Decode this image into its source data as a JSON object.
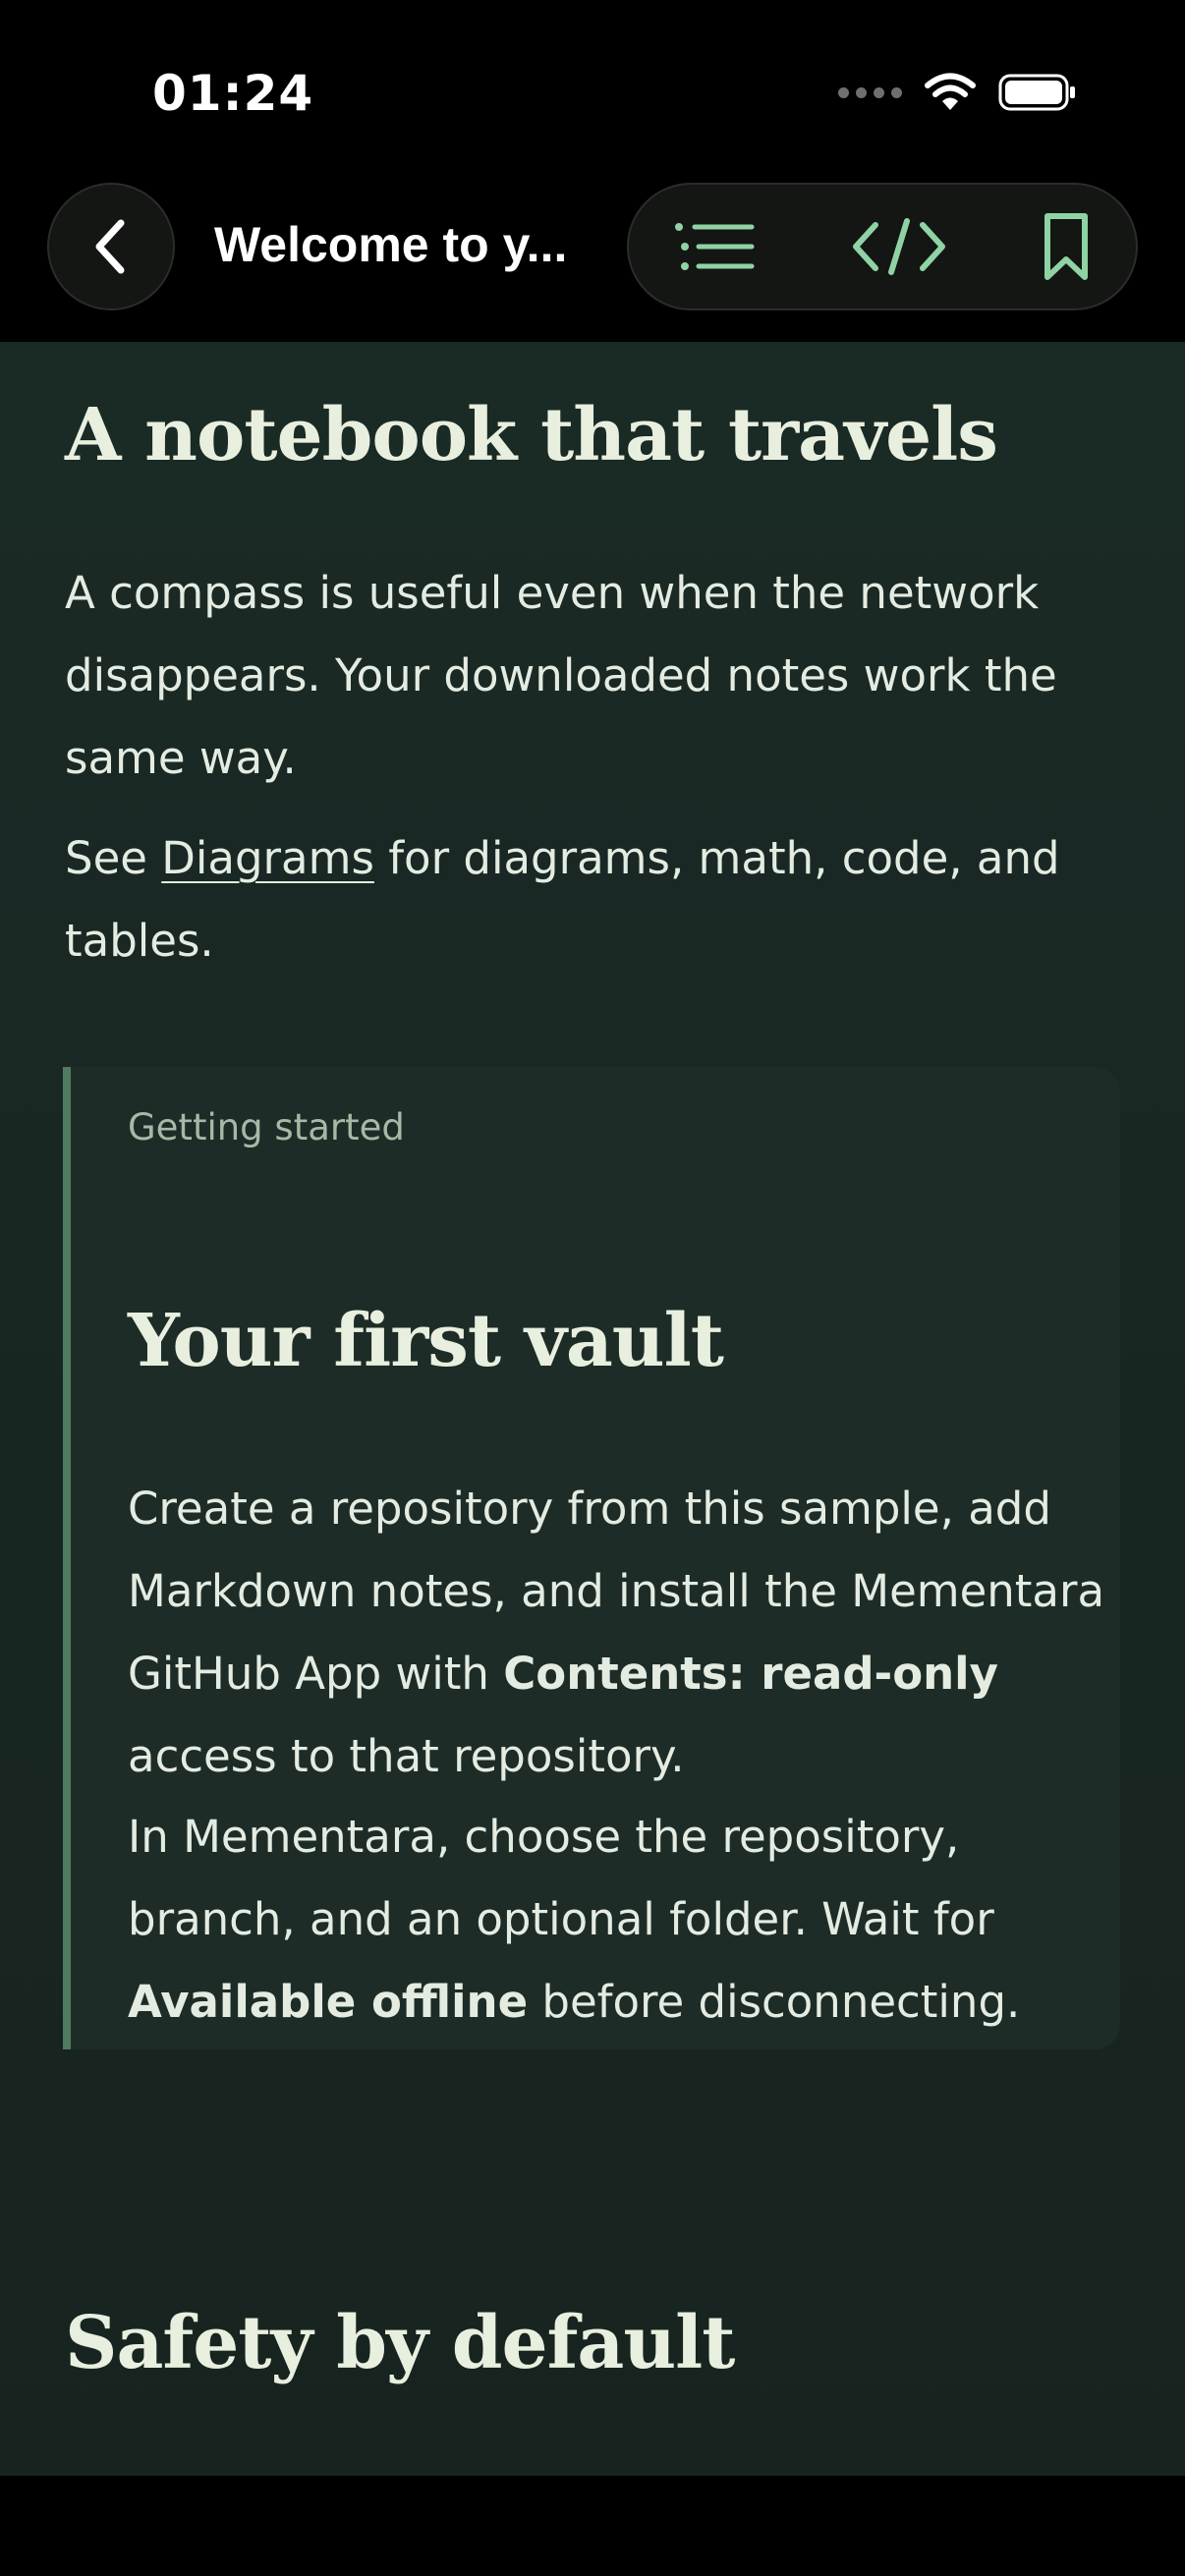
{
  "status": {
    "time": "01:24"
  },
  "nav": {
    "title": "Welcome to y...",
    "icons": [
      "chevron-left-icon",
      "list-icon",
      "code-icon",
      "bookmark-icon"
    ]
  },
  "colors": {
    "accent": "#8fd3a4",
    "background": "#1a2a25",
    "callout_border": "#4f7b62"
  },
  "content": {
    "heading1": "A notebook that travels",
    "para1": "A compass is useful even when the network disappears. Your downloaded notes work the same way.",
    "para2_prefix": "See ",
    "para2_link": "Diagrams",
    "para2_suffix": " for diagrams, math, code, and tables.",
    "callout": {
      "label": "Getting started",
      "heading": "Your first vault",
      "p1_a": "Create a repository from this sample, add Markdown notes, and install the Mementara GitHub App with ",
      "p1_bold": "Contents: read-only",
      "p1_b": " access to that repository.",
      "p2_a": "In Mementara, choose the repository, branch, and an optional folder. Wait for ",
      "p2_bold": "Available offline",
      "p2_b": " before disconnecting."
    },
    "heading2": "Safety by default"
  }
}
